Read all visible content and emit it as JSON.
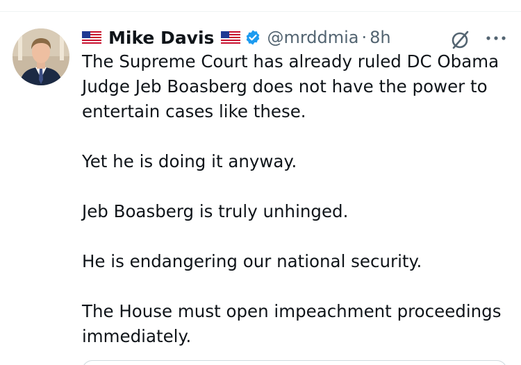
{
  "tweet": {
    "display_name": "Mike Davis",
    "name_prefix_emoji": "us-flag-icon",
    "name_suffix_emoji": "us-flag-icon",
    "verified_badge": "verified-check-icon",
    "handle": "@mrddmia",
    "separator": "·",
    "time": "8h",
    "paragraphs": [
      "The Supreme Court has already ruled DC Obama Judge Jeb Boasberg does not have the power to entertain cases like these.",
      "Yet he is doing it anyway.",
      "Jeb Boasberg is truly unhinged.",
      "He is endangering our national security.",
      "The House must open impeachment proceedings immediately."
    ]
  },
  "icons": {
    "grok": "grok-icon",
    "more": "more-options-icon"
  },
  "colors": {
    "text": "#0f1419",
    "secondary": "#536471",
    "verified": "#1d9bf0",
    "divider": "#eff3f4"
  }
}
